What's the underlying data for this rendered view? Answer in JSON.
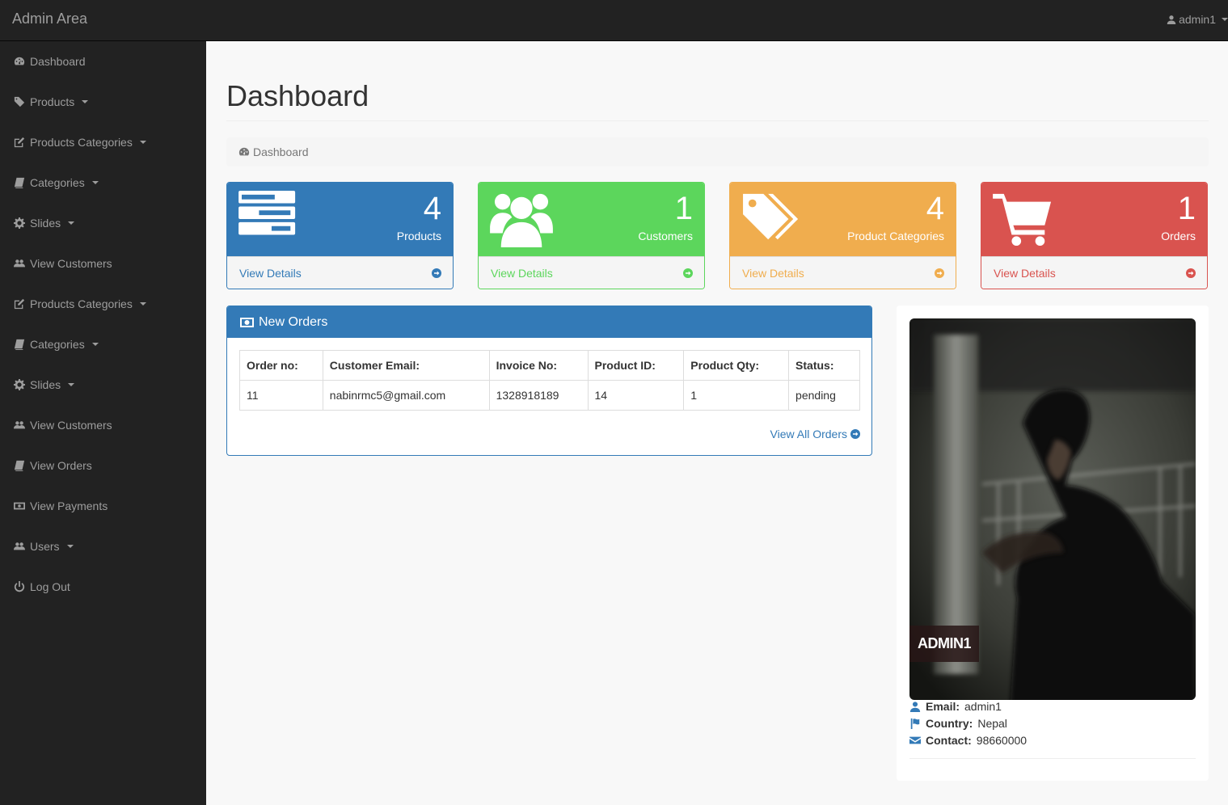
{
  "topbar": {
    "brand": "Admin Area",
    "user": "admin1"
  },
  "sidebar": {
    "items": [
      {
        "label": "Dashboard",
        "icon": "dashboard-icon",
        "caret": false
      },
      {
        "label": "Products",
        "icon": "tag-icon",
        "caret": true
      },
      {
        "label": "Products Categories",
        "icon": "edit-icon",
        "caret": true
      },
      {
        "label": "Categories",
        "icon": "book-icon",
        "caret": true
      },
      {
        "label": "Slides",
        "icon": "gear-icon",
        "caret": true
      },
      {
        "label": "View Customers",
        "icon": "users-icon",
        "caret": false
      },
      {
        "label": "Products Categories",
        "icon": "edit-icon",
        "caret": true
      },
      {
        "label": "Categories",
        "icon": "book-icon",
        "caret": true
      },
      {
        "label": "Slides",
        "icon": "gear-icon",
        "caret": true
      },
      {
        "label": "View Customers",
        "icon": "users-icon",
        "caret": false
      },
      {
        "label": "View Orders",
        "icon": "book-icon",
        "caret": false
      },
      {
        "label": "View Payments",
        "icon": "money-icon",
        "caret": false
      },
      {
        "label": "Users",
        "icon": "users-icon",
        "caret": true
      },
      {
        "label": "Log Out",
        "icon": "power-icon",
        "caret": false
      }
    ]
  },
  "page": {
    "title": "Dashboard",
    "breadcrumb": "Dashboard"
  },
  "cards": [
    {
      "count": "4",
      "label": "Products",
      "link": "View Details",
      "color": "#337ab7",
      "icon": "tasks-icon"
    },
    {
      "count": "1",
      "label": "Customers",
      "link": "View Details",
      "color": "#5cd65c",
      "icon": "users-icon"
    },
    {
      "count": "4",
      "label": "Product Categories",
      "link": "View Details",
      "color": "#f0ad4e",
      "icon": "tags-icon"
    },
    {
      "count": "1",
      "label": "Orders",
      "link": "View Details",
      "color": "#d9534f",
      "icon": "shopping-cart-icon"
    }
  ],
  "orders": {
    "title": "New Orders",
    "columns": [
      "Order no:",
      "Customer Email:",
      "Invoice No:",
      "Product ID:",
      "Product Qty:",
      "Status:"
    ],
    "rows": [
      [
        "11",
        "nabinrmc5@gmail.com",
        "1328918189",
        "14",
        "1",
        "pending"
      ]
    ],
    "view_all": "View All Orders"
  },
  "profile": {
    "name": "ADMIN1",
    "email_label": "Email:",
    "email": "admin1",
    "country_label": "Country:",
    "country": "Nepal",
    "contact_label": "Contact:",
    "contact": "98660000"
  }
}
